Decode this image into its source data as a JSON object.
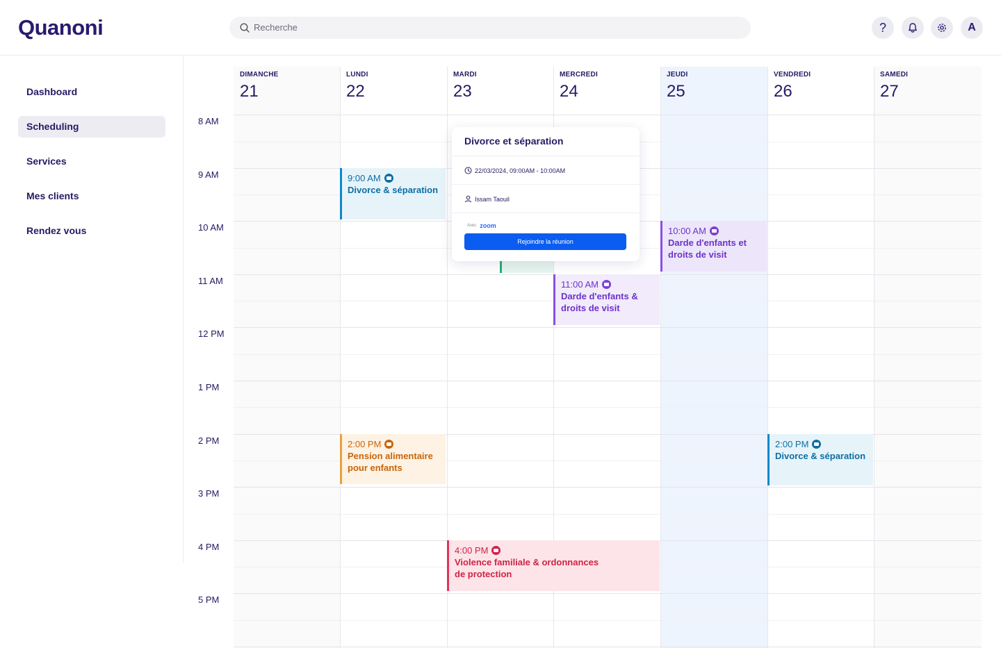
{
  "header": {
    "logo": "Quanoni",
    "search_placeholder": "Recherche",
    "help_label": "?",
    "avatar_initial": "A"
  },
  "sidebar": {
    "items": [
      {
        "label": "Dashboard",
        "active": false
      },
      {
        "label": "Scheduling",
        "active": true
      },
      {
        "label": "Services",
        "active": false
      },
      {
        "label": "Mes clients",
        "active": false
      },
      {
        "label": "Rendez vous",
        "active": false
      }
    ]
  },
  "calendar": {
    "days": [
      {
        "name": "DIMANCHE",
        "num": "21"
      },
      {
        "name": "LUNDI",
        "num": "22"
      },
      {
        "name": "MARDI",
        "num": "23"
      },
      {
        "name": "MERCREDI",
        "num": "24"
      },
      {
        "name": "JEUDI",
        "num": "25"
      },
      {
        "name": "VENDREDI",
        "num": "26"
      },
      {
        "name": "SAMEDI",
        "num": "27"
      }
    ],
    "times": [
      "8 AM",
      "9 AM",
      "10 AM",
      "11 AM",
      "12 PM",
      "1 PM",
      "2 PM",
      "3 PM",
      "4 PM",
      "5 PM"
    ],
    "events": [
      {
        "time": "9:00 AM",
        "title": "Divorce & séparation"
      },
      {
        "time": "10:00 AM",
        "title": "Darde d'enfants et droits de visit"
      },
      {
        "time": "11:00 AM",
        "title": "Darde d'enfants & droits de visit"
      },
      {
        "time": "2:00 PM",
        "title": "Pension alimentaire pour enfants"
      },
      {
        "time": "2:00 PM",
        "title": "Divorce & séparation"
      },
      {
        "time": "4:00 PM",
        "title": "Violence familiale & ordonnances de protection"
      }
    ]
  },
  "popup": {
    "title": "Divorce et séparation",
    "datetime": "22/03/2024, 09:00AM - 10:00AM",
    "person": "Issam Taouil",
    "avec": "Avec",
    "provider": "zoom",
    "join_label": "Rejoindre la réunion"
  },
  "colors": {
    "brand": "#2a1a6e",
    "primary_button": "#0b5cf0",
    "today_column": "#eef4fd",
    "event_blue": "#0d6ea3",
    "event_purple": "#7c3fd6",
    "event_orange": "#c9650a",
    "event_red": "#cf2246",
    "event_green": "#22b07d"
  }
}
